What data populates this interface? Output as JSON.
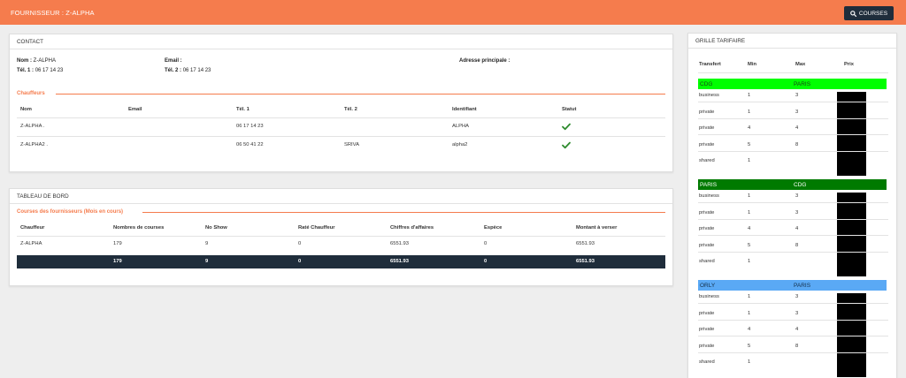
{
  "header": {
    "title": "FOURNISSEUR : Z-ALPHA",
    "courses_button": "COURSES"
  },
  "contact": {
    "title": "CONTACT",
    "nom_label": "Nom :",
    "nom_value": "Z-ALPHA",
    "tel1_label": "Tél. 1 :",
    "tel1_value": "06 17 14 23",
    "email_label": "Email :",
    "email_value": "",
    "tel2_label": "Tél. 2 :",
    "tel2_value": "06 17 14 23",
    "adresse_label": "Adresse principale :",
    "chauffeurs_title": "Chauffeurs",
    "columns": [
      "Nom",
      "Email",
      "Tél. 1",
      "Tél. 2",
      "Identifiant",
      "Statut"
    ],
    "rows": [
      {
        "nom": "Z-ALPHA .",
        "email": "",
        "tel1": "06 17 14 23",
        "tel2": "",
        "identifiant": "ALPHA",
        "statut": "active"
      },
      {
        "nom": "Z-ALPHA2 .",
        "email": "",
        "tel1": "06 50 41 22",
        "tel2": "SRIVA",
        "identifiant": "alpha2",
        "statut": "active"
      }
    ]
  },
  "tableau": {
    "title": "TABLEAU DE BORD",
    "section_title": "Courses des fournisseurs (Mois en cours)",
    "columns": [
      "Chauffeur",
      "Nombres de courses",
      "No Show",
      "Raté Chauffeur",
      "Chiffres d'affaires",
      "Espèce",
      "Montant à verser"
    ],
    "rows": [
      [
        "Z-ALPHA",
        "179",
        "9",
        "0",
        "6551.93",
        "0",
        "6551.93"
      ]
    ],
    "totals": [
      "",
      "179",
      "9",
      "0",
      "6551.93",
      "0",
      "6551.93"
    ]
  },
  "grille": {
    "title": "GRILLE TARIFAIRE",
    "columns": [
      "Transfert",
      "Min",
      "Max",
      "Prix"
    ],
    "routes": [
      {
        "from": "CDG",
        "to": "PARIS",
        "color": "#00ff00",
        "text_color": "#1a3d1a",
        "rows": [
          {
            "type": "business",
            "min": "1",
            "max": "3"
          },
          {
            "type": "private",
            "min": "1",
            "max": "3"
          },
          {
            "type": "private",
            "min": "4",
            "max": "4"
          },
          {
            "type": "private",
            "min": "5",
            "max": "8"
          },
          {
            "type": "shared",
            "min": "1",
            "max": ""
          }
        ]
      },
      {
        "from": "PARIS",
        "to": "CDG",
        "color": "#007a00",
        "text_color": "#ffffff",
        "rows": [
          {
            "type": "business",
            "min": "1",
            "max": "3"
          },
          {
            "type": "private",
            "min": "1",
            "max": "3"
          },
          {
            "type": "private",
            "min": "4",
            "max": "4"
          },
          {
            "type": "private",
            "min": "5",
            "max": "8"
          },
          {
            "type": "shared",
            "min": "1",
            "max": ""
          }
        ]
      },
      {
        "from": "ORLY",
        "to": "PARIS",
        "color": "#5aa9f5",
        "text_color": "#16304a",
        "rows": [
          {
            "type": "business",
            "min": "1",
            "max": "3"
          },
          {
            "type": "private",
            "min": "1",
            "max": "3"
          },
          {
            "type": "private",
            "min": "4",
            "max": "4"
          },
          {
            "type": "private",
            "min": "5",
            "max": "8"
          },
          {
            "type": "shared",
            "min": "1",
            "max": ""
          }
        ]
      }
    ]
  },
  "colors": {
    "accent": "#f57c4d",
    "dark": "#1f2d3b",
    "check": "#2e8b2e"
  }
}
